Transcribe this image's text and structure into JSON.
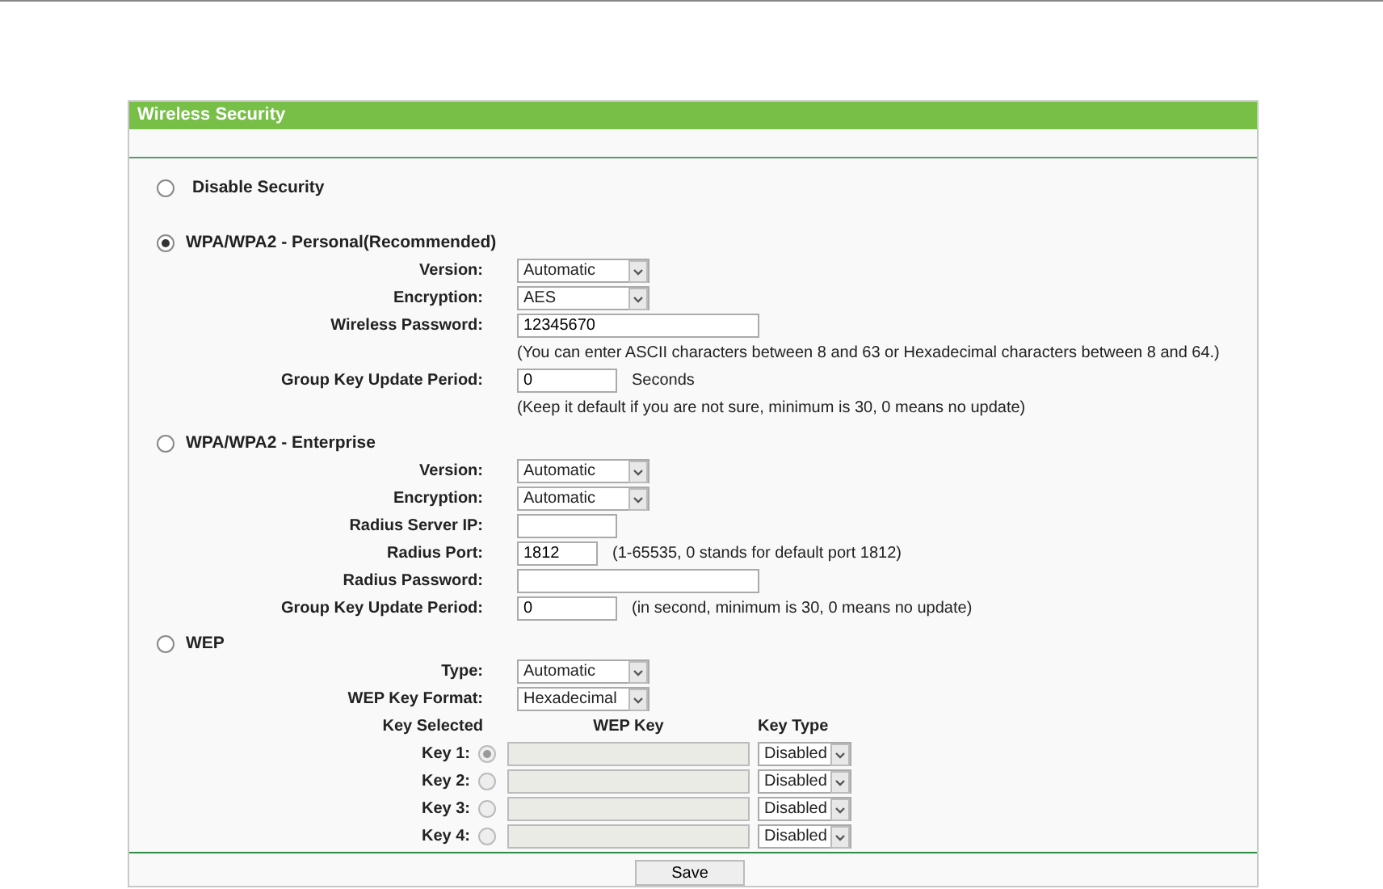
{
  "panel": {
    "title": "Wireless Security"
  },
  "sections": [
    {
      "title": "Disable Security",
      "selected": false
    },
    {
      "title": "WPA/WPA2 - Personal(Recommended)",
      "selected": true,
      "fields": [
        {
          "label": "Version:",
          "kind": "select",
          "value": "Automatic"
        },
        {
          "label": "Encryption:",
          "kind": "select",
          "value": "AES"
        },
        {
          "label": "Wireless Password:",
          "kind": "wide",
          "value": "12345670",
          "note": "(You can enter ASCII characters between 8 and 63 or Hexadecimal characters between 8 and 64.)"
        },
        {
          "label": "Group Key Update Period:",
          "kind": "medium",
          "value": "0",
          "suffix": "Seconds",
          "note": "(Keep it default if you are not sure, minimum is 30, 0 means no update)"
        }
      ]
    },
    {
      "title": "WPA/WPA2 - Enterprise",
      "selected": false,
      "fields": [
        {
          "label": "Version:",
          "kind": "select",
          "value": "Automatic"
        },
        {
          "label": "Encryption:",
          "kind": "select",
          "value": "Automatic"
        },
        {
          "label": "Radius Server IP:",
          "kind": "medium"
        },
        {
          "label": "Radius Port:",
          "kind": "short",
          "value": "1812",
          "suffix": "(1-65535, 0 stands for default port 1812)"
        },
        {
          "label": "Radius Password:",
          "kind": "wide"
        },
        {
          "label": "Group Key Update Period:",
          "kind": "medium",
          "value": "0",
          "suffix": "(in second, minimum is 30, 0 means no update)"
        }
      ]
    },
    {
      "title": "WEP",
      "selected": false,
      "fields": [
        {
          "label": "Type:",
          "kind": "select",
          "value": "Automatic"
        },
        {
          "label": "WEP Key Format:",
          "kind": "select",
          "value": "Hexadecimal"
        }
      ],
      "keys": {
        "headers": [
          "Key Selected",
          "WEP Key",
          "Key Type"
        ],
        "rows": [
          {
            "label": "Key 1:",
            "selected": true,
            "disabled": true,
            "type": "Disabled"
          },
          {
            "label": "Key 2:",
            "selected": false,
            "disabled": true,
            "type": "Disabled"
          },
          {
            "label": "Key 3:",
            "selected": false,
            "disabled": true,
            "type": "Disabled"
          },
          {
            "label": "Key 4:",
            "selected": false,
            "disabled": true,
            "type": "Disabled"
          }
        ]
      }
    }
  ],
  "save_button": "Save"
}
